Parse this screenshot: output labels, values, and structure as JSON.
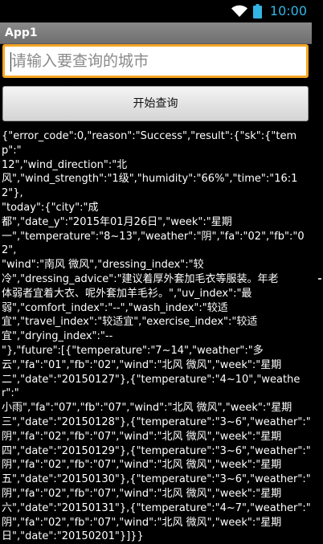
{
  "status_bar": {
    "time": "10:00",
    "icons": [
      "wifi-icon",
      "battery-icon"
    ],
    "accent_color": "#33B5E5"
  },
  "app": {
    "title": "App1"
  },
  "search": {
    "placeholder": "请输入要查询的城市",
    "value": "",
    "focus_color": "#F5A623"
  },
  "query_button": {
    "label": "开始查询"
  },
  "response": {
    "lines": [
      "{\"error_code\":0,\"reason\":\"Success\",\"result\":{\"sk\":{\"temp\":\"",
      "12\",\"wind_direction\":\"北",
      "风\",\"wind_strength\":\"1级\",\"humidity\":\"66%\",\"time\":\"16:12\"},",
      "\"today\":{\"city\":\"成",
      "都\",\"date_y\":\"2015年01月26日\",\"week\":\"星期",
      "一\",\"temperature\":\"8~13\",\"weather\":\"阴\",\"fa\":\"02\",\"fb\":\"02\",",
      "\"wind\":\"南风 微风\",\"dressing_index\":\"较",
      "冷\",\"dressing_advice\":\"建议着厚外套加毛衣等服装。年老",
      "体弱者宜着大衣、呢外套加羊毛衫。\",\"uv_index\":\"最",
      "弱\",\"comfort_index\":\"--\",\"wash_index\":\"较适",
      "宜\",\"travel_index\":\"较适宜\",\"exercise_index\":\"较适",
      "宜\",\"drying_index\":\"--",
      "\"},\"future\":[{\"temperature\":\"7~14\",\"weather\":\"多",
      "云\",\"fa\":\"01\",\"fb\":\"02\",\"wind\":\"北风 微风\",\"week\":\"星期",
      "二\",\"date\":\"20150127\"},{\"temperature\":\"4~10\",\"weather\":\"",
      "小雨\",\"fa\":\"07\",\"fb\":\"07\",\"wind\":\"北风 微风\",\"week\":\"星期",
      "三\",\"date\":\"20150128\"},{\"temperature\":\"3~6\",\"weather\":\"",
      "阴\",\"fa\":\"02\",\"fb\":\"07\",\"wind\":\"北风 微风\",\"week\":\"星期",
      "四\",\"date\":\"20150129\"},{\"temperature\":\"3~6\",\"weather\":\"",
      "阴\",\"fa\":\"02\",\"fb\":\"07\",\"wind\":\"北风 微风\",\"week\":\"星期",
      "五\",\"date\":\"20150130\"},{\"temperature\":\"3~6\",\"weather\":\"",
      "阴\",\"fa\":\"02\",\"fb\":\"07\",\"wind\":\"北风 微风\",\"week\":\"星期",
      "六\",\"date\":\"20150131\"},{\"temperature\":\"4~7\",\"weather\":\"",
      "阴\",\"fa\":\"02\",\"fb\":\"07\",\"wind\":\"北风 微风\",\"week\":\"星期",
      "日\",\"date\":\"20150201\"}]}}"
    ]
  }
}
